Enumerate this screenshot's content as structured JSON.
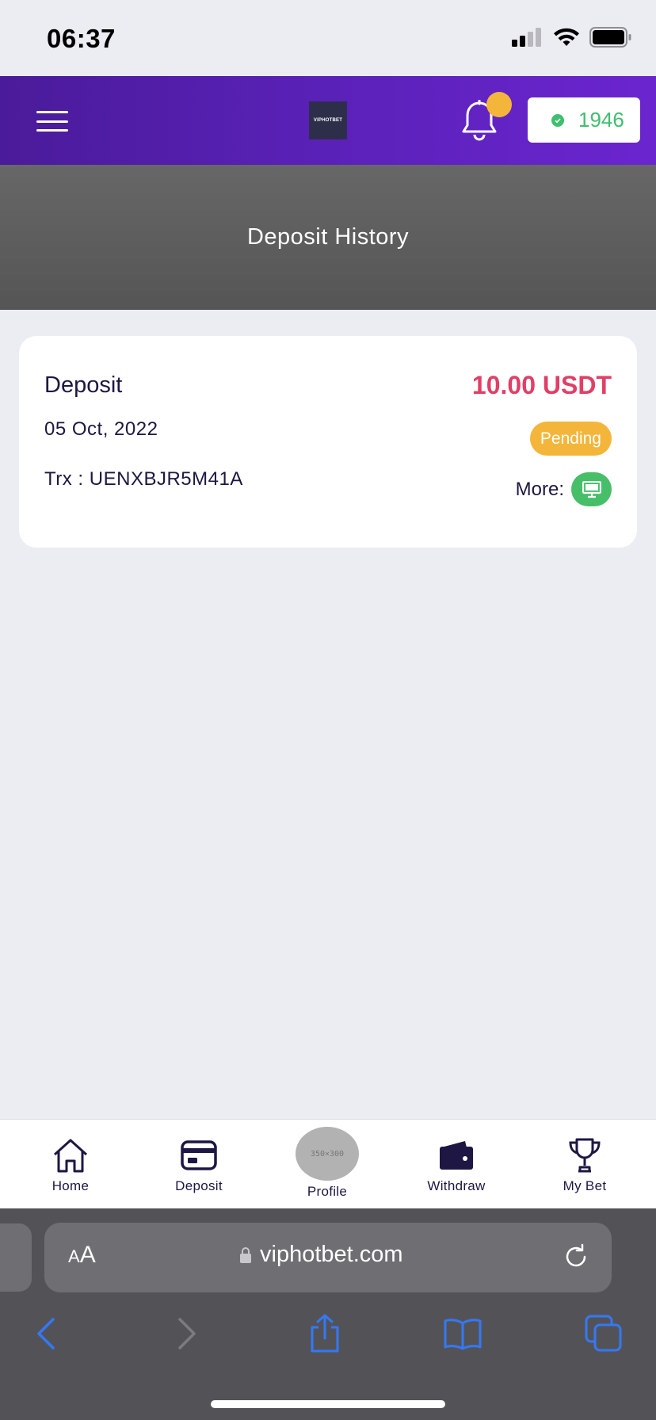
{
  "status_bar": {
    "time": "06:37"
  },
  "header": {
    "logo_text": "VIPHOTBET",
    "balance": "1946"
  },
  "page": {
    "title": "Deposit History"
  },
  "deposit_card": {
    "label": "Deposit",
    "date": "05 Oct, 2022",
    "trx": "Trx : UENXBJR5M41A",
    "amount": "10.00 USDT",
    "status": "Pending",
    "more_label": "More:"
  },
  "bottom_nav": {
    "home": "Home",
    "deposit": "Deposit",
    "profile": "Profile",
    "profile_placeholder": "350×300",
    "withdraw": "Withdraw",
    "my_bet": "My Bet"
  },
  "browser": {
    "aa_small": "A",
    "aa_big": "A",
    "url": "viphotbet.com"
  },
  "colors": {
    "header_start": "#4a1b9a",
    "header_end": "#6b25cf",
    "amount": "#e03f66",
    "pending": "#f4b63a",
    "more_button": "#47bf68",
    "balance_text": "#3fbf6f",
    "safari_accent": "#3478f6"
  }
}
